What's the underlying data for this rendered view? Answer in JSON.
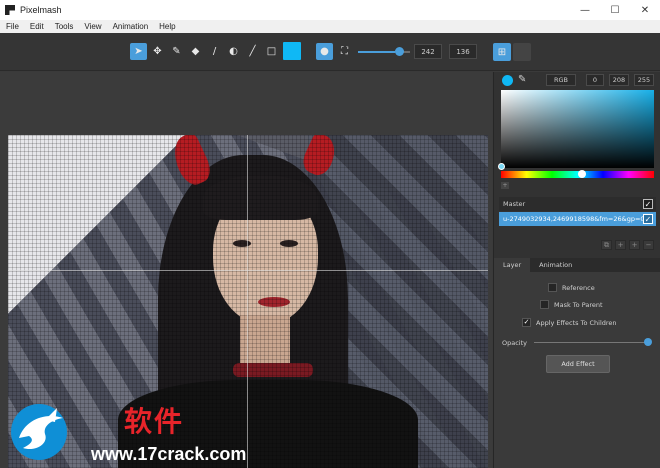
{
  "window": {
    "title": "Pixelmash",
    "minimize": "—",
    "maximize": "☐",
    "close": "✕"
  },
  "menu": [
    "File",
    "Edit",
    "Tools",
    "View",
    "Animation",
    "Help"
  ],
  "toolbar": {
    "tools": [
      {
        "name": "select-tool",
        "glyph": "➤",
        "active": true
      },
      {
        "name": "move-tool",
        "glyph": "✥",
        "active": false
      },
      {
        "name": "pencil-tool",
        "glyph": "✎",
        "active": false
      },
      {
        "name": "eraser-tool",
        "glyph": "◆",
        "active": false
      },
      {
        "name": "brush-tool",
        "glyph": "/",
        "active": false
      },
      {
        "name": "dodge-burn-tool",
        "glyph": "◐",
        "active": false
      },
      {
        "name": "line-tool",
        "glyph": "╱",
        "active": false
      },
      {
        "name": "rectangle-tool",
        "glyph": "□",
        "active": false
      }
    ],
    "color": "#0fb8f5",
    "brush_shape_round": "●",
    "brush_shape_square": "⛶",
    "size_fill": 0.72,
    "width": "242",
    "height": "136",
    "grid_toggle": "⊞"
  },
  "watermark": {
    "cn": "软件",
    "url": "www.17crack.com"
  },
  "panel": {
    "mode": "RGB",
    "r": "0",
    "g": "208",
    "b": "255",
    "master_label": "Master",
    "frame_label": "u-2749032934,2469918598&fm=26&gp=0.j",
    "layer_buttons": [
      "⧉",
      "+",
      "+",
      "−"
    ],
    "tabs": [
      "Layer",
      "Animation"
    ],
    "reference": "Reference",
    "mask_to_parent": "Mask To Parent",
    "apply_effects": "Apply Effects To Children",
    "opacity": "Opacity",
    "opacity_value": 1.0,
    "add_effect": "Add Effect"
  }
}
